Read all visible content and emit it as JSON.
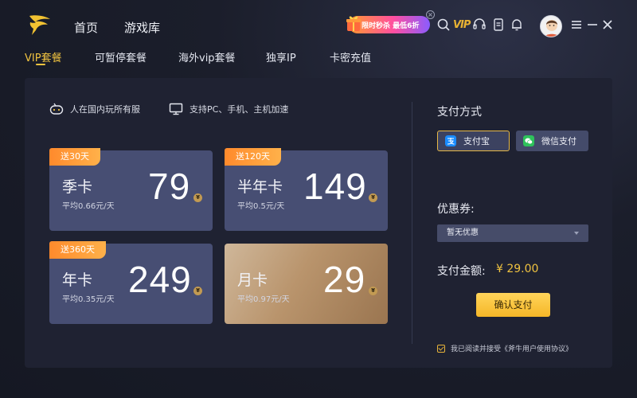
{
  "nav": {
    "home": "首页",
    "library": "游戏库"
  },
  "promo": {
    "text": "限时秒杀 最低6折",
    "close": "×"
  },
  "toolbar": {
    "vip": "VIP",
    "avatar_icon": "user-avatar-icon"
  },
  "tabs": [
    {
      "label": "VIP套餐",
      "active": true
    },
    {
      "label": "可暂停套餐"
    },
    {
      "label": "海外vip套餐"
    },
    {
      "label": "独享IP"
    },
    {
      "label": "卡密充值"
    }
  ],
  "features": [
    {
      "icon": "gamepad-icon",
      "text": "人在国内玩所有服"
    },
    {
      "icon": "monitor-icon",
      "text": "支持PC、手机、主机加速"
    }
  ],
  "plans": [
    {
      "badge": "送30天",
      "name": "季卡",
      "price": "79",
      "avg": "平均0.66元/天",
      "coin": "¥"
    },
    {
      "badge": "送120天",
      "name": "半年卡",
      "price": "149",
      "avg": "平均0.5元/天",
      "coin": "¥"
    },
    {
      "badge": "送360天",
      "name": "年卡",
      "price": "249",
      "avg": "平均0.35元/天",
      "coin": "¥"
    },
    {
      "name": "月卡",
      "price": "29",
      "avg": "平均0.97元/天",
      "coin": "¥"
    }
  ],
  "payment": {
    "title": "支付方式",
    "alipay": "支付宝",
    "wechat": "微信支付",
    "coupon_title": "优惠券:",
    "coupon_value": "暂无优惠",
    "total_label": "支付金额:",
    "total_value": "¥ 29.00",
    "confirm": "确认支付",
    "agree_text": "我已阅读并接受《斧牛用户使用协议》"
  },
  "colors": {
    "accent": "#f0c340",
    "card": "#474e73",
    "panel": "#1f2232"
  }
}
